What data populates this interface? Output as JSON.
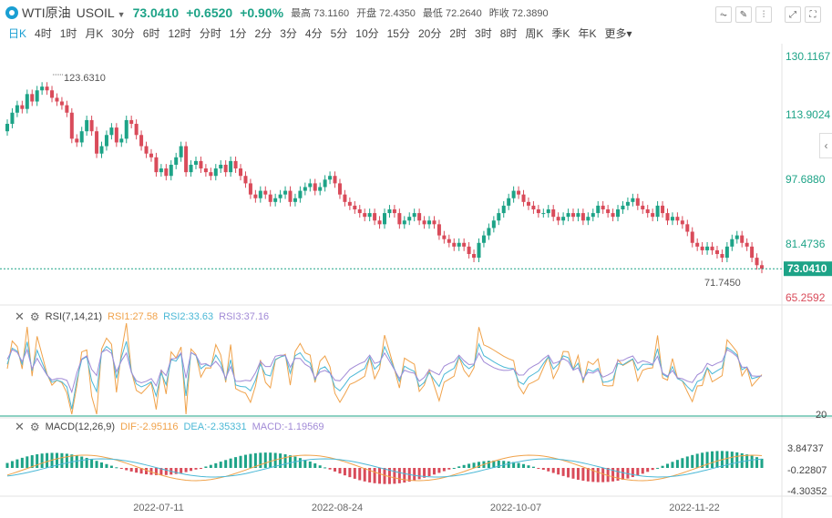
{
  "header": {
    "name": "WTI原油",
    "symbol": "USOIL",
    "price": "73.0410",
    "change": "+0.6520",
    "change_pct": "+0.90%",
    "high_label": "最高",
    "high": "73.1160",
    "open_label": "开盘",
    "open": "72.4350",
    "low_label": "最低",
    "low": "72.2640",
    "prev_label": "昨收",
    "prev": "72.3890"
  },
  "periods": [
    "日K",
    "4时",
    "1时",
    "月K",
    "30分",
    "6时",
    "12时",
    "分时",
    "1分",
    "2分",
    "3分",
    "4分",
    "5分",
    "10分",
    "15分",
    "20分",
    "2时",
    "3时",
    "8时",
    "周K",
    "季K",
    "年K",
    "更多"
  ],
  "active_period": "日K",
  "icons": [
    "line-icon",
    "pen-icon",
    "candle-icon",
    "expand-icon",
    "fullscreen-icon"
  ],
  "colors": {
    "up": "#1da387",
    "down": "#d94b5a",
    "rsi1": "#f0a24a",
    "rsi2": "#4bb8d6",
    "rsi3": "#a18ad6",
    "accent": "#1a9fd3"
  },
  "price_axis": [
    "130.1167",
    "113.9024",
    "97.6880",
    "81.4736",
    "65.2592"
  ],
  "current_price_tag": "73.0410",
  "max_label": "123.6310",
  "min_label": "71.7450",
  "rsi": {
    "label": "RSI(7,14,21)",
    "rsi1": "RSI1:27.58",
    "rsi2": "RSI2:33.63",
    "rsi3": "RSI3:37.16",
    "axis_20": "20"
  },
  "macd": {
    "label": "MACD(12,26,9)",
    "dif": "DIF:-2.95116",
    "dea": "DEA:-2.35331",
    "macd": "MACD:-1.19569",
    "axis": [
      "3.84737",
      "-0.22807",
      "-4.30352"
    ]
  },
  "dates": [
    "2022-07-11",
    "2022-08-24",
    "2022-10-07",
    "2022-11-22"
  ],
  "chart_data": {
    "type": "candlestick",
    "ylim": [
      65.2592,
      130.1167
    ],
    "closes": [
      112,
      115,
      117,
      116,
      120,
      118,
      121,
      122,
      121,
      119,
      118,
      117,
      115,
      108,
      107,
      110,
      113,
      110,
      104,
      106,
      109,
      111,
      107,
      108,
      113,
      112,
      109,
      106,
      104,
      103,
      99,
      100,
      98,
      101,
      103,
      106,
      99,
      101,
      102,
      100,
      99,
      98,
      100,
      101,
      99,
      102,
      100,
      98,
      96,
      93,
      92,
      94,
      93,
      91,
      92,
      93,
      94,
      91,
      92,
      94,
      95,
      96,
      94,
      95,
      97,
      98,
      96,
      93,
      91,
      90,
      89,
      88,
      87,
      88,
      86,
      85,
      88,
      89,
      88,
      85,
      86,
      87,
      88,
      86,
      85,
      86,
      85,
      82,
      81,
      80,
      79,
      80,
      79,
      77,
      76,
      80,
      82,
      84,
      86,
      88,
      90,
      92,
      94,
      93,
      91,
      90,
      89,
      88,
      88,
      89,
      87,
      86,
      87,
      88,
      87,
      88,
      86,
      87,
      88,
      90,
      89,
      88,
      87,
      89,
      90,
      91,
      92,
      90,
      89,
      88,
      87,
      90,
      88,
      86,
      87,
      86,
      85,
      83,
      80,
      79,
      78,
      79,
      78,
      77,
      76,
      79,
      81,
      82,
      80,
      79,
      76,
      74,
      73.04
    ]
  }
}
